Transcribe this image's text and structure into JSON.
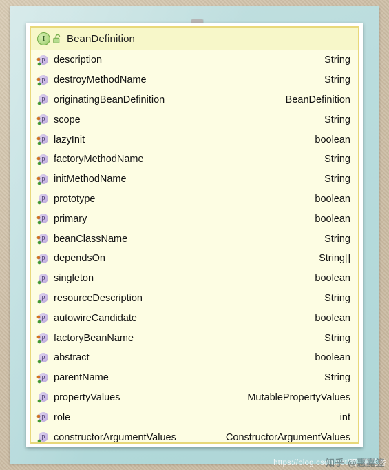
{
  "window": {
    "top_tab_name": "drag-handle"
  },
  "header": {
    "title": "BeanDefinition",
    "type_icon": "interface-icon",
    "type_icon_letter": "I",
    "visibility_icon": "unlocked-padlock-icon",
    "background_color": "#f7f7c9"
  },
  "colors": {
    "card_background": "#fdfde3",
    "card_border": "#e8d87a",
    "pane_background": "#b9dcdd",
    "desktop_background": "#cdbea6",
    "property_icon": "#b6a2d6",
    "writable_dot": "#d4701d",
    "readable_dot": "#3d9a2f",
    "interface_icon": "#8dc25f"
  },
  "members": [
    {
      "icon": "property-icon",
      "letter": "p",
      "name": "description",
      "type": "String",
      "writable": true,
      "readable": true
    },
    {
      "icon": "property-icon",
      "letter": "p",
      "name": "destroyMethodName",
      "type": "String",
      "writable": true,
      "readable": true
    },
    {
      "icon": "property-icon",
      "letter": "p",
      "name": "originatingBeanDefinition",
      "type": "BeanDefinition",
      "writable": false,
      "readable": true
    },
    {
      "icon": "property-icon",
      "letter": "p",
      "name": "scope",
      "type": "String",
      "writable": true,
      "readable": true
    },
    {
      "icon": "property-icon",
      "letter": "p",
      "name": "lazyInit",
      "type": "boolean",
      "writable": true,
      "readable": true
    },
    {
      "icon": "property-icon",
      "letter": "p",
      "name": "factoryMethodName",
      "type": "String",
      "writable": true,
      "readable": true
    },
    {
      "icon": "property-icon",
      "letter": "p",
      "name": "initMethodName",
      "type": "String",
      "writable": true,
      "readable": true
    },
    {
      "icon": "property-icon",
      "letter": "p",
      "name": "prototype",
      "type": "boolean",
      "writable": false,
      "readable": true
    },
    {
      "icon": "property-icon",
      "letter": "p",
      "name": "primary",
      "type": "boolean",
      "writable": true,
      "readable": true
    },
    {
      "icon": "property-icon",
      "letter": "p",
      "name": "beanClassName",
      "type": "String",
      "writable": true,
      "readable": true
    },
    {
      "icon": "property-icon",
      "letter": "p",
      "name": "dependsOn",
      "type": "String[]",
      "writable": true,
      "readable": true
    },
    {
      "icon": "property-icon",
      "letter": "p",
      "name": "singleton",
      "type": "boolean",
      "writable": false,
      "readable": true
    },
    {
      "icon": "property-icon",
      "letter": "p",
      "name": "resourceDescription",
      "type": "String",
      "writable": false,
      "readable": true
    },
    {
      "icon": "property-icon",
      "letter": "p",
      "name": "autowireCandidate",
      "type": "boolean",
      "writable": true,
      "readable": true
    },
    {
      "icon": "property-icon",
      "letter": "p",
      "name": "factoryBeanName",
      "type": "String",
      "writable": true,
      "readable": true
    },
    {
      "icon": "property-icon",
      "letter": "p",
      "name": "abstract",
      "type": "boolean",
      "writable": false,
      "readable": true
    },
    {
      "icon": "property-icon",
      "letter": "p",
      "name": "parentName",
      "type": "String",
      "writable": true,
      "readable": true
    },
    {
      "icon": "property-icon",
      "letter": "p",
      "name": "propertyValues",
      "type": "MutablePropertyValues",
      "writable": false,
      "readable": true
    },
    {
      "icon": "property-icon",
      "letter": "p",
      "name": "role",
      "type": "int",
      "writable": true,
      "readable": true
    },
    {
      "icon": "property-icon",
      "letter": "p",
      "name": "constructorArgumentValues",
      "type": "ConstructorArgumentValues",
      "writable": false,
      "readable": true
    }
  ],
  "watermarks": {
    "url": "https://blog.csdn.net/百_菊花香",
    "overlay": "知乎 @惠嘉签"
  }
}
